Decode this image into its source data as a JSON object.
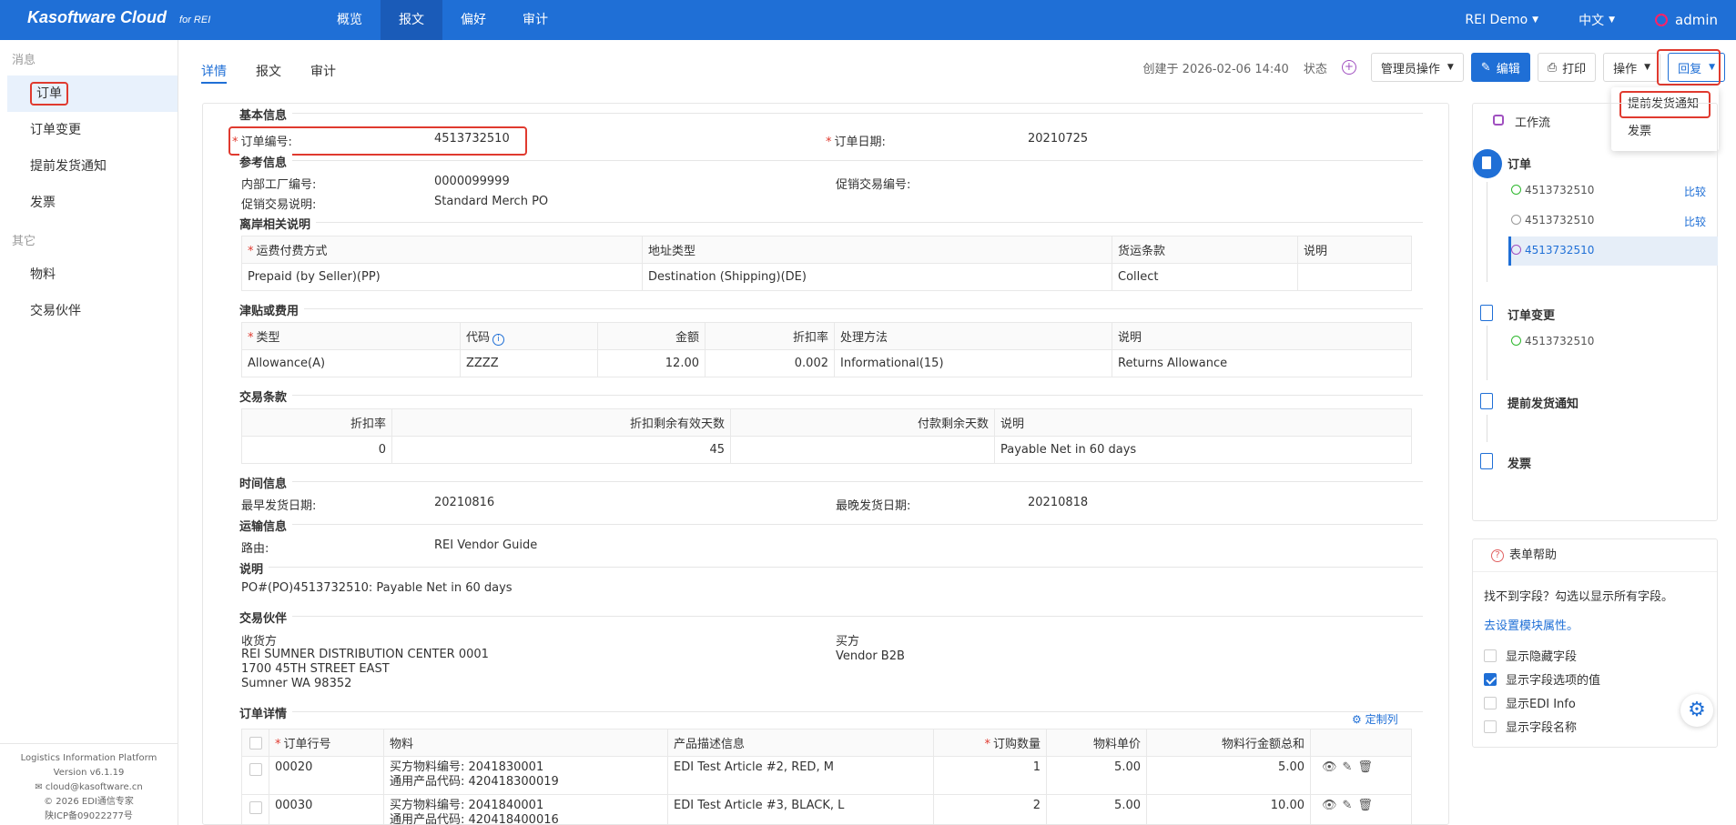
{
  "brand": {
    "name": "Kasoftware Cloud",
    "sub": "for REI"
  },
  "nav": [
    "概览",
    "报文",
    "偏好",
    "审计"
  ],
  "top_right": {
    "org": "REI Demo",
    "lang": "中文",
    "user": "admin"
  },
  "sidebar": {
    "group1": "消息",
    "items1": [
      "订单",
      "订单变更",
      "提前发货通知",
      "发票"
    ],
    "group2": "其它",
    "items2": [
      "物料",
      "交易伙伴"
    ],
    "footer": [
      "Logistics Information Platform",
      "Version v6.1.19",
      "cloud@kasoftware.cn",
      "© 2026 EDI通信专家",
      "陕ICP备09022277号"
    ]
  },
  "tabs": [
    "详情",
    "报文",
    "审计"
  ],
  "header": {
    "created": "创建于 2026-02-06 14:40",
    "status_label": "状态",
    "admin_ops": "管理员操作",
    "edit": "编辑",
    "print": "打印",
    "ops": "操作",
    "reply": "回复"
  },
  "dropdown": [
    "提前发货通知",
    "发票"
  ],
  "form": {
    "sec_basic": "基本信息",
    "order_no_label": "订单编号:",
    "order_no": "4513732510",
    "order_date_label": "订单日期:",
    "order_date": "20210725",
    "sec_ref": "参考信息",
    "plant_label": "内部工厂编号:",
    "plant": "0000099999",
    "promo_no_label": "促销交易编号:",
    "promo_desc_label": "促销交易说明:",
    "promo_desc": "Standard Merch PO",
    "sec_fob": "离岸相关说明",
    "fob_headers": [
      "运费付费方式",
      "地址类型",
      "货运条款",
      "说明"
    ],
    "fob_row": [
      "Prepaid (by Seller)(PP)",
      "Destination (Shipping)(DE)",
      "Collect",
      ""
    ],
    "sec_allow": "津贴或费用",
    "allow_headers": [
      "类型",
      "代码",
      "金额",
      "折扣率",
      "处理方法",
      "说明"
    ],
    "allow_row": [
      "Allowance(A)",
      "ZZZZ",
      "12.00",
      "0.002",
      "Informational(15)",
      "Returns Allowance"
    ],
    "sec_terms": "交易条款",
    "terms_headers": [
      "折扣率",
      "折扣剩余有效天数",
      "付款剩余天数",
      "说明"
    ],
    "terms_row": [
      "0",
      "45",
      "",
      "Payable Net in 60 days"
    ],
    "sec_time": "时间信息",
    "earliest_label": "最早发货日期:",
    "earliest": "20210816",
    "latest_label": "最晚发货日期:",
    "latest": "20210818",
    "sec_ship": "运输信息",
    "route_label": "路由:",
    "route": "REI Vendor Guide",
    "sec_note": "说明",
    "note": "PO#(PO)4513732510: Payable Net in 60 days",
    "sec_partner": "交易伙伴",
    "shipto_label": "收货方",
    "shipto": [
      "REI SUMNER DISTRIBUTION CENTER 0001",
      "1700 45TH STREET EAST",
      "Sumner WA 98352"
    ],
    "buyer_label": "买方",
    "buyer": "Vendor B2B",
    "sec_lines": "订单详情",
    "customize": "定制列",
    "line_headers": [
      "订单行号",
      "物料",
      "产品描述信息",
      "订购数量",
      "物料单价",
      "物料行金额总和"
    ],
    "lines": [
      {
        "no": "00020",
        "mat1": "买方物料编号: 2041830001",
        "mat2": "通用产品代码: 420418300019",
        "desc": "EDI Test Article #2, RED, M",
        "qty": "1",
        "price": "5.00",
        "total": "5.00"
      },
      {
        "no": "00030",
        "mat1": "买方物料编号: 2041840001",
        "mat2": "通用产品代码: 420418400016",
        "desc": "EDI Test Article #3, BLACK, L",
        "qty": "2",
        "price": "5.00",
        "total": "10.00"
      }
    ]
  },
  "workflow": {
    "title": "工作流",
    "nodes": [
      {
        "label": "订单",
        "subs": [
          "4513732510",
          "4513732510",
          "4513732510"
        ],
        "compare": "比较"
      },
      {
        "label": "订单变更",
        "subs": [
          "4513732510"
        ]
      },
      {
        "label": "提前发货通知"
      },
      {
        "label": "发票"
      }
    ]
  },
  "help": {
    "title": "表单帮助",
    "text": "找不到字段？勾选以显示所有字段。",
    "link": "去设置模块属性。",
    "options": [
      "显示隐藏字段",
      "显示字段选项的值",
      "显示EDI Info",
      "显示字段名称"
    ]
  }
}
